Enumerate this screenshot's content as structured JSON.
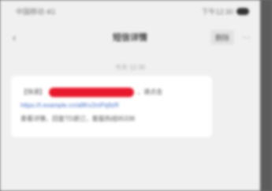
{
  "colors": {
    "redaction": "#e8192c",
    "link": "#4a72c9",
    "background": "#f0f0f0",
    "bubble": "#ffffff"
  },
  "status_bar": {
    "carrier": "中国移动 4G",
    "time": "下午12:30",
    "battery_icon": "battery-icon"
  },
  "nav": {
    "back_icon": "back-icon",
    "title": "短信详情",
    "action_label": "删除",
    "more_icon": "more-icon"
  },
  "message": {
    "timestamp": "今天 12:30",
    "prefix": "【快递】",
    "suffix": "，请点击",
    "link_text": "https://t.example.cn/a8Kx2mPq9zR",
    "footer": "查看详情，回复TD退订，客服热线95338"
  }
}
